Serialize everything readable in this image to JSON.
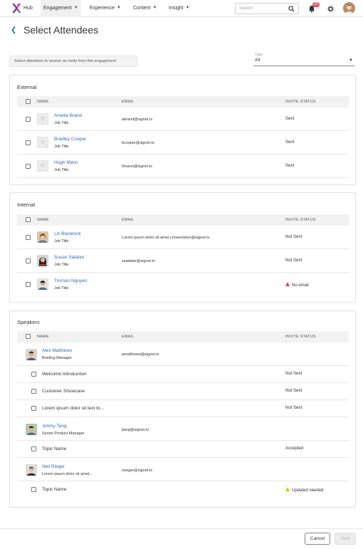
{
  "app": {
    "name": "Hub",
    "nav": [
      {
        "label": "Engagement",
        "active": true
      },
      {
        "label": "Experience",
        "active": false
      },
      {
        "label": "Content",
        "active": false
      },
      {
        "label": "Insight",
        "active": false
      }
    ],
    "search_placeholder": "Search",
    "notification_count": "20",
    "brand_color": "#6b3fa0",
    "icons": [
      "x-logo-icon",
      "chevron-down-icon",
      "search-icon",
      "bell-icon",
      "gear-icon"
    ]
  },
  "page": {
    "title": "Select Attendees",
    "hint": "Select attendees to receive an invite from this engagement",
    "type_label": "Type",
    "type_value": "All"
  },
  "columns": {
    "name": "NAME",
    "email": "EMAIL",
    "status": "INVITE STATUS"
  },
  "external": {
    "title": "External",
    "rows": [
      {
        "name": "Amelia Brand",
        "title": "Job Title",
        "email": "abrand@signet.tv",
        "status": "Sent"
      },
      {
        "name": "Bradley Cooper",
        "title": "Job Title",
        "email": "bcooper@signet.tv",
        "status": "Sent"
      },
      {
        "name": "Hugh Mann",
        "title": "Job Title",
        "email": "hmann@signet.tv",
        "status": "Sent"
      }
    ]
  },
  "internal": {
    "title": "Internal",
    "rows": [
      {
        "name": "Liz Blacklock",
        "title": "Job Title",
        "email": "Lorem ipsum dolor sit amet consectetun@signet.tv",
        "status": "Not Sent"
      },
      {
        "name": "Susan Salaber",
        "title": "Job Title",
        "email": "ssalaber@signet.tv",
        "status": "Not Sent"
      },
      {
        "name": "Truman Nguyen",
        "title": "Job Title",
        "email": "",
        "status": "No email"
      }
    ]
  },
  "speakers": {
    "title": "Speakers",
    "people": [
      {
        "name": "Alex Matthews",
        "title": "Briefing Manager",
        "email": "amatthews@signet.tv",
        "sessions": [
          {
            "label": "Welcome Introduction",
            "status": "Not Sent"
          },
          {
            "label": "Customer Showcase",
            "status": "Not Sent"
          },
          {
            "label": "Lorem ipsum dolor sit text to...",
            "status": "Not Sent"
          }
        ]
      },
      {
        "name": "Jimmy Tang",
        "title": "Senior Product Manager",
        "email": "jtang@signet.tv",
        "sessions": [
          {
            "label": "Topic Name",
            "status": "Accepted"
          }
        ]
      },
      {
        "name": "Neil Rieger",
        "title": "Lorem ipsum dolor sit amet...",
        "email": "nrieger@signet.tv",
        "sessions": [
          {
            "label": "Topic Name",
            "status": "Updated needed"
          }
        ]
      }
    ]
  },
  "footer": {
    "cancel": "Cancel",
    "next": "Next"
  }
}
